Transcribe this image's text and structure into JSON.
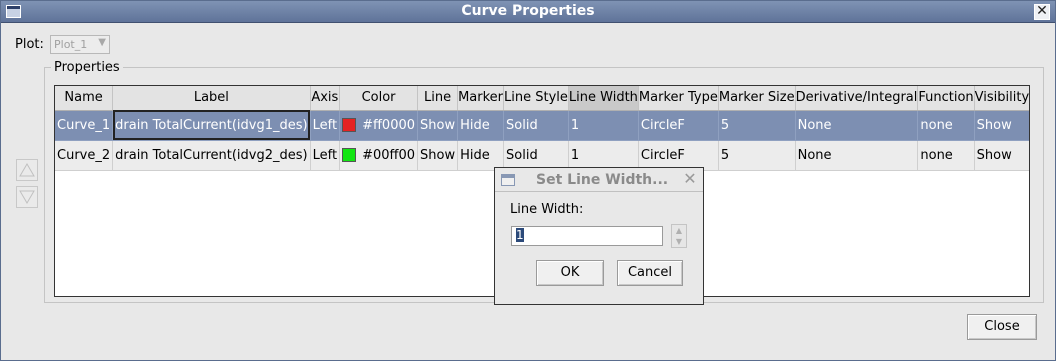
{
  "window": {
    "title": "Curve Properties",
    "close_glyph": "✕"
  },
  "plot": {
    "label": "Plot:",
    "selected": "Plot_1",
    "arrow": "▼"
  },
  "properties": {
    "title": "Properties",
    "columns": [
      "Name",
      "Label",
      "Axis",
      "Color",
      "Line",
      "Marker",
      "Line Style",
      "Line Width",
      "Marker Type",
      "Marker Size",
      "Derivative/Integral",
      "Function",
      "Visibility"
    ],
    "rows": [
      {
        "name": "Curve_1",
        "label": "drain TotalCurrent(idvg1_des)",
        "axis": "Left",
        "color_hex": "#ff0000",
        "color_text": "#ff0000",
        "line": "Show",
        "marker": "Hide",
        "line_style": "Solid",
        "line_width": "1",
        "marker_type": "CircleF",
        "marker_size": "5",
        "derivative": "None",
        "function": "none",
        "visibility": "Show",
        "swatch": "#e52222"
      },
      {
        "name": "Curve_2",
        "label": "drain TotalCurrent(idvg2_des)",
        "axis": "Left",
        "color_hex": "#00ff00",
        "color_text": "#00ff00",
        "line": "Show",
        "marker": "Hide",
        "line_style": "Solid",
        "line_width": "1",
        "marker_type": "CircleF",
        "marker_size": "5",
        "derivative": "None",
        "function": "none",
        "visibility": "Show",
        "swatch": "#12e612"
      }
    ]
  },
  "move_buttons": {
    "up_icon": "arrow-up-icon",
    "down_icon": "arrow-down-icon"
  },
  "dialog": {
    "title": "Set Line Width...",
    "label": "Line Width:",
    "value": "1",
    "ok": "OK",
    "cancel": "Cancel",
    "close_glyph": "✕",
    "spin_up": "▲",
    "spin_down": "▼"
  },
  "footer": {
    "close": "Close"
  },
  "colors": {
    "titlebar": "#6a7fa6",
    "selection": "#7d8fb2",
    "sorted_header": "#c9c9c9"
  }
}
